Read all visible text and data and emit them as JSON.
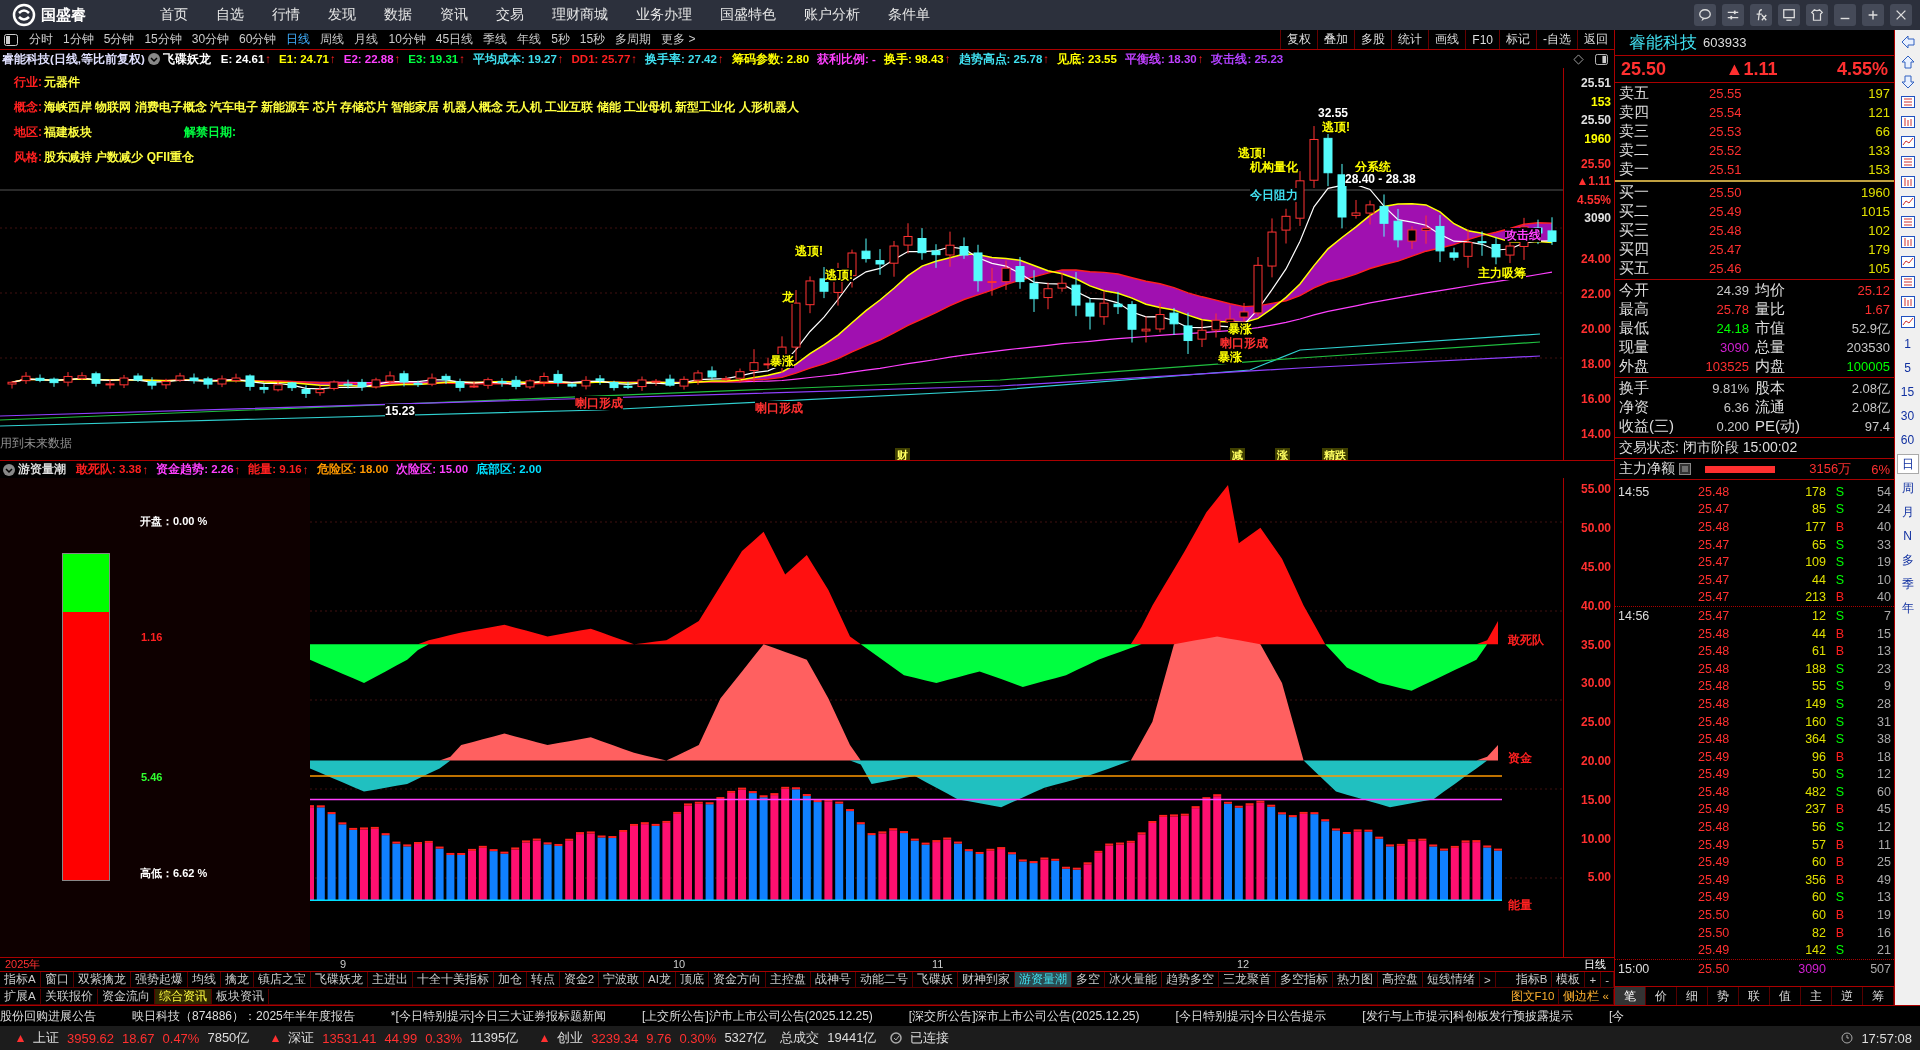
{
  "app": {
    "name": "国盛睿",
    "menu": [
      "首页",
      "自选",
      "行情",
      "发现",
      "数据",
      "资讯",
      "交易",
      "理财商城",
      "业务办理",
      "国盛特色",
      "账户分析",
      "条件单"
    ]
  },
  "period_bar": {
    "items": [
      {
        "label": "分时",
        "selected": false
      },
      {
        "label": "1分钟",
        "selected": false
      },
      {
        "label": "5分钟",
        "selected": false
      },
      {
        "label": "15分钟",
        "selected": false
      },
      {
        "label": "30分钟",
        "selected": false
      },
      {
        "label": "60分钟",
        "selected": false
      },
      {
        "label": "日线",
        "selected": true
      },
      {
        "label": "周线",
        "selected": false
      },
      {
        "label": "月线",
        "selected": false
      },
      {
        "label": "10分钟",
        "selected": false
      },
      {
        "label": "45日线",
        "selected": false
      },
      {
        "label": "季线",
        "selected": false
      },
      {
        "label": "年线",
        "selected": false
      },
      {
        "label": "5秒",
        "selected": false
      },
      {
        "label": "15秒",
        "selected": false
      },
      {
        "label": "多周期",
        "selected": false
      },
      {
        "label": "更多 >",
        "selected": false
      }
    ],
    "tools": [
      "复权",
      "叠加",
      "多股",
      "统计",
      "画线",
      "F10",
      "标记",
      "-自选",
      "返回"
    ]
  },
  "stock_header": {
    "title": "睿能科技(日线,等比前复权)",
    "indicator": "飞碟妖龙",
    "values": [
      {
        "label": "E:",
        "value": "24.61",
        "color": "#ffffff",
        "arrow": "↑"
      },
      {
        "label": "E1:",
        "value": "24.71",
        "color": "#ffff00",
        "arrow": "↑"
      },
      {
        "label": "E2:",
        "value": "22.88",
        "color": "#ff40ff",
        "arrow": "↑"
      },
      {
        "label": "E3:",
        "value": "19.31",
        "color": "#00ff40",
        "arrow": "↑"
      },
      {
        "label": "平均成本:",
        "value": "19.27",
        "color": "#40e0f0",
        "arrow": "↑"
      },
      {
        "label": "DD1:",
        "value": "25.77",
        "color": "#ff2020",
        "arrow": "↑"
      },
      {
        "label": "换手率:",
        "value": "27.42",
        "color": "#40e0f0",
        "arrow": "↑"
      },
      {
        "label": "筹码参数:",
        "value": "2.80",
        "color": "#ffff00"
      },
      {
        "label": "获利比例:",
        "value": "-",
        "color": "#ff40ff"
      },
      {
        "label": "换手:",
        "value": "98.43",
        "color": "#ffff00",
        "arrow": "↑"
      },
      {
        "label": "趋势高点:",
        "value": "25.78",
        "color": "#40e0f0",
        "arrow": "↑"
      },
      {
        "label": "见底:",
        "value": "23.55",
        "color": "#ffff00"
      },
      {
        "label": "平衡线:",
        "value": "18.30",
        "color": "#c040ff",
        "arrow": "↑"
      },
      {
        "label": "攻击线:",
        "value": "25.23",
        "color": "#b040ff"
      }
    ]
  },
  "info_lines": [
    [
      {
        "label": "行业:",
        "value": "元器件",
        "color": "#ff2020"
      }
    ],
    [
      {
        "label": "概念:",
        "value": "海峡西岸 物联网 消费电子概念 汽车电子 新能源车 芯片 存储芯片 智能家居 机器人概念 无人机 工业互联 储能 工业母机 新型工业化 人形机器人",
        "color": "#ff2020"
      }
    ],
    [
      {
        "label": "地区:",
        "value": "福建板块",
        "color": "#ff2020"
      },
      {
        "label": "解禁日期:",
        "color": "#00ff40"
      }
    ],
    [
      {
        "label": "风格:",
        "value": "股东减持 户数减少 QFII重仓",
        "color": "#ff2020"
      }
    ]
  ],
  "main_chart": {
    "y_axis": [
      {
        "text": "25.51",
        "color": "#e0e0e0"
      },
      {
        "text": "153",
        "color": "#ffff00"
      },
      {
        "text": "25.50",
        "color": "#e0e0e0"
      },
      {
        "text": "1960",
        "color": "#ffff00"
      },
      {
        "text": "25.50",
        "color": "#ff3030"
      },
      {
        "text": "▲1.11",
        "color": "#ff3030"
      },
      {
        "text": "4.55%",
        "color": "#ff3030"
      },
      {
        "text": "3090",
        "color": "#e0e0e0"
      },
      {
        "text": "24.00",
        "color": "#ff3030"
      },
      {
        "text": "22.00",
        "color": "#ff3030"
      },
      {
        "text": "20.00",
        "color": "#ff3030"
      },
      {
        "text": "18.00",
        "color": "#ff3030"
      },
      {
        "text": "16.00",
        "color": "#ff3030"
      },
      {
        "text": "14.00",
        "color": "#ff3030"
      }
    ],
    "annotations": [
      {
        "text": "32.55",
        "kind": "price"
      },
      {
        "text": "逃顶!",
        "kind": "signal"
      },
      {
        "text": "逃顶!",
        "kind": "signal"
      },
      {
        "text": "机构量化",
        "kind": "signal"
      },
      {
        "text": "分系统",
        "kind": "signal"
      },
      {
        "text": "28.40 - 28.38",
        "kind": "price"
      },
      {
        "text": "今日阻力",
        "kind": "info"
      },
      {
        "text": "攻击线",
        "kind": "line"
      },
      {
        "text": "主力吸筹",
        "kind": "signal"
      },
      {
        "text": "逃顶!",
        "kind": "signal"
      },
      {
        "text": "逃顶!",
        "kind": "signal"
      },
      {
        "text": "龙",
        "kind": "signal"
      },
      {
        "text": "暴涨",
        "kind": "signal"
      },
      {
        "text": "15.23",
        "kind": "price"
      },
      {
        "text": "喇口形成",
        "kind": "warning"
      },
      {
        "text": "喇口形成",
        "kind": "warning"
      },
      {
        "text": "暴涨",
        "kind": "signal"
      },
      {
        "text": "喇口形成",
        "kind": "warning"
      },
      {
        "text": "暴涨",
        "kind": "signal"
      },
      {
        "text": "用到未来数据",
        "kind": "note"
      },
      {
        "text": "财",
        "kind": "mark"
      },
      {
        "text": "减",
        "kind": "mark"
      },
      {
        "text": "涨",
        "kind": "mark"
      },
      {
        "text": "精跌",
        "kind": "mark"
      }
    ]
  },
  "indicator": {
    "title": "游资量潮",
    "values": [
      {
        "label": "敢死队:",
        "value": "3.38",
        "color": "#ff2020",
        "arrow": "↑"
      },
      {
        "label": "资金趋势:",
        "value": "2.26",
        "color": "#ff40ff",
        "arrow": "↑"
      },
      {
        "label": "能量:",
        "value": "9.16",
        "color": "#ff2020",
        "arrow": "↑"
      },
      {
        "label": "危险区:",
        "value": "18.00",
        "color": "#ff9900"
      },
      {
        "label": "次险区:",
        "value": "15.00",
        "color": "#ff40ff"
      },
      {
        "label": "底部区:",
        "value": "2.00",
        "color": "#00e0ff"
      }
    ],
    "panel": {
      "open": "开盘：0.00 %",
      "upper": "1.16",
      "lower": "5.46",
      "range": "高低：6.62 %"
    },
    "y_axis": [
      "55.00",
      "50.00",
      "45.00",
      "40.00",
      "35.00",
      "30.00",
      "25.00",
      "20.00",
      "15.00",
      "10.00",
      "5.00"
    ],
    "series_labels": [
      {
        "text": "敢死队",
        "color": "#ff2020"
      },
      {
        "text": "资金",
        "color": "#ff2020"
      },
      {
        "text": "能量",
        "color": "#ff2020"
      }
    ]
  },
  "x_axis": {
    "labels": [
      "2025年",
      "9",
      "10",
      "11",
      "12"
    ],
    "period": "日线"
  },
  "indicator_tabs": {
    "items": [
      {
        "label": "指标A",
        "selected": false
      },
      {
        "label": "窗口",
        "selected": false
      },
      {
        "label": "双紫擒龙",
        "selected": false
      },
      {
        "label": "强势起爆",
        "selected": false
      },
      {
        "label": "均线",
        "selected": false
      },
      {
        "label": "擒龙",
        "selected": false
      },
      {
        "label": "镇店之宝",
        "selected": false
      },
      {
        "label": "飞碟妖龙",
        "selected": false
      },
      {
        "label": "主进出",
        "selected": false
      },
      {
        "label": "十全十美指标",
        "selected": false
      },
      {
        "label": "加仓",
        "selected": false
      },
      {
        "label": "转点",
        "selected": false
      },
      {
        "label": "资金2",
        "selected": false
      },
      {
        "label": "宁波敢",
        "selected": false
      },
      {
        "label": "AI龙",
        "selected": false
      },
      {
        "label": "顶底",
        "selected": false
      },
      {
        "label": "资金方向",
        "selected": false
      },
      {
        "label": "主控盘",
        "selected": false
      },
      {
        "label": "战神号",
        "selected": false
      },
      {
        "label": "动能二号",
        "selected": false
      },
      {
        "label": "飞碟妖",
        "selected": false
      },
      {
        "label": "财神到家",
        "selected": false
      },
      {
        "label": "游资量潮",
        "selected": true
      },
      {
        "label": "多空",
        "selected": false
      },
      {
        "label": "冰火量能",
        "selected": false
      },
      {
        "label": "趋势多空",
        "selected": false
      },
      {
        "label": "三龙聚首",
        "selected": false
      },
      {
        "label": "多空指标",
        "selected": false
      },
      {
        "label": "热力图",
        "selected": false
      },
      {
        "label": "高控盘",
        "selected": false
      },
      {
        "label": "短线情绪",
        "selected": false
      },
      {
        "label": ">",
        "selected": false
      }
    ],
    "right": [
      "指标B",
      "模板",
      "+",
      "-"
    ]
  },
  "extension_tabs": {
    "items": [
      {
        "label": "扩展A",
        "selected": false
      },
      {
        "label": "关联报价",
        "selected": false
      },
      {
        "label": "资金流向",
        "selected": false
      },
      {
        "label": "综合资讯",
        "selected": true
      },
      {
        "label": "板块资讯",
        "selected": false
      }
    ],
    "right": [
      "图文F10",
      "侧边栏 «"
    ]
  },
  "quote": {
    "name": "睿能科技",
    "code": "603933",
    "price": "25.50",
    "change": "▲1.11",
    "percent": "4.55%",
    "asks": [
      {
        "label": "卖五",
        "price": "25.55",
        "volume": "197"
      },
      {
        "label": "卖四",
        "price": "25.54",
        "volume": "121"
      },
      {
        "label": "卖三",
        "price": "25.53",
        "volume": "66"
      },
      {
        "label": "卖二",
        "price": "25.52",
        "volume": "133"
      },
      {
        "label": "卖一",
        "price": "25.51",
        "volume": "153"
      }
    ],
    "bids": [
      {
        "label": "买一",
        "price": "25.50",
        "volume": "1960"
      },
      {
        "label": "买二",
        "price": "25.49",
        "volume": "1015"
      },
      {
        "label": "买三",
        "price": "25.48",
        "volume": "102"
      },
      {
        "label": "买四",
        "price": "25.47",
        "volume": "179"
      },
      {
        "label": "买五",
        "price": "25.46",
        "volume": "105"
      }
    ],
    "stat_blocks": [
      [
        {
          "label": "今开",
          "value": "24.39",
          "color": "#c8c8c8"
        },
        {
          "label": "均价",
          "value": "25.12",
          "color": "#ff3030"
        },
        {
          "label": "最高",
          "value": "25.78",
          "color": "#ff3030"
        },
        {
          "label": "量比",
          "value": "1.67",
          "color": "#ff3030"
        },
        {
          "label": "最低",
          "value": "24.18",
          "color": "#00ff00"
        },
        {
          "label": "市值",
          "value": "52.9亿",
          "color": "#c8c8c8"
        },
        {
          "label": "现量",
          "value": "3090",
          "color": "#d020d0"
        },
        {
          "label": "总量",
          "value": "203530",
          "color": "#c8c8c8"
        },
        {
          "label": "外盘",
          "value": "103525",
          "color": "#ff3030"
        },
        {
          "label": "内盘",
          "value": "100005",
          "color": "#00ff00"
        }
      ],
      [
        {
          "label": "换手",
          "value": "9.81%",
          "color": "#c8c8c8"
        },
        {
          "label": "股本",
          "value": "2.08亿",
          "color": "#c8c8c8"
        },
        {
          "label": "净资",
          "value": "6.36",
          "color": "#c8c8c8"
        },
        {
          "label": "流通",
          "value": "2.08亿",
          "color": "#c8c8c8"
        },
        {
          "label": "收益(三)",
          "value": "0.200",
          "color": "#c8c8c8"
        },
        {
          "label": "PE(动)",
          "value": "97.4",
          "color": "#c8c8c8"
        }
      ]
    ],
    "trade_status": "交易状态: 闭市阶段 15:00:02",
    "main_force": {
      "label": "主力净额",
      "value": "3156万",
      "percent": "6%"
    },
    "ticks": [
      {
        "time": "14:55",
        "price": "25.48",
        "volume": "178",
        "side": "S",
        "kind": "sell",
        "count": "54"
      },
      {
        "price": "25.47",
        "volume": "85",
        "side": "S",
        "kind": "sell",
        "count": "24"
      },
      {
        "price": "25.48",
        "volume": "177",
        "side": "B",
        "kind": "buy",
        "count": "40"
      },
      {
        "price": "25.47",
        "volume": "65",
        "side": "S",
        "kind": "sell",
        "count": "33"
      },
      {
        "price": "25.47",
        "volume": "109",
        "side": "S",
        "kind": "sell",
        "count": "19"
      },
      {
        "price": "25.47",
        "volume": "44",
        "side": "S",
        "kind": "sell",
        "count": "10"
      },
      {
        "price": "25.47",
        "volume": "213",
        "side": "B",
        "kind": "buy",
        "count": "40"
      },
      {
        "time": "14:56",
        "price": "25.47",
        "volume": "12",
        "side": "S",
        "kind": "sell",
        "count": "7"
      },
      {
        "price": "25.48",
        "volume": "44",
        "side": "B",
        "kind": "buy",
        "count": "15"
      },
      {
        "price": "25.48",
        "volume": "61",
        "side": "B",
        "kind": "buy",
        "count": "13"
      },
      {
        "price": "25.48",
        "volume": "188",
        "side": "S",
        "kind": "sell",
        "count": "23"
      },
      {
        "price": "25.48",
        "volume": "55",
        "side": "S",
        "kind": "sell",
        "count": "9"
      },
      {
        "price": "25.48",
        "volume": "149",
        "side": "S",
        "kind": "sell",
        "count": "28"
      },
      {
        "price": "25.48",
        "volume": "160",
        "side": "S",
        "kind": "sell",
        "count": "31"
      },
      {
        "price": "25.48",
        "volume": "364",
        "side": "S",
        "kind": "sell",
        "count": "38"
      },
      {
        "price": "25.49",
        "volume": "96",
        "side": "B",
        "kind": "buy",
        "count": "18"
      },
      {
        "price": "25.49",
        "volume": "50",
        "side": "S",
        "kind": "sell",
        "count": "12"
      },
      {
        "price": "25.48",
        "volume": "482",
        "side": "S",
        "kind": "sell",
        "count": "60"
      },
      {
        "price": "25.49",
        "volume": "237",
        "side": "B",
        "kind": "buy",
        "count": "45"
      },
      {
        "price": "25.48",
        "volume": "56",
        "side": "S",
        "kind": "sell",
        "count": "12"
      },
      {
        "price": "25.49",
        "volume": "57",
        "side": "B",
        "kind": "buy",
        "count": "11"
      },
      {
        "price": "25.49",
        "volume": "60",
        "side": "B",
        "kind": "buy",
        "count": "25"
      },
      {
        "price": "25.49",
        "volume": "356",
        "side": "B",
        "kind": "buy",
        "count": "49"
      },
      {
        "price": "25.49",
        "volume": "60",
        "side": "S",
        "kind": "sell",
        "count": "13"
      },
      {
        "price": "25.50",
        "volume": "60",
        "side": "B",
        "kind": "buy",
        "count": "19"
      },
      {
        "price": "25.50",
        "volume": "82",
        "side": "B",
        "kind": "buy",
        "count": "16"
      },
      {
        "price": "25.49",
        "volume": "142",
        "side": "S",
        "kind": "sell",
        "count": "21"
      },
      {
        "time": "15:00",
        "price": "25.50",
        "volume": "3090",
        "kind": "close",
        "count": "507"
      }
    ],
    "bottom_tabs": [
      {
        "label": "笔",
        "selected": true
      },
      {
        "label": "价",
        "selected": false
      },
      {
        "label": "细",
        "selected": false
      },
      {
        "label": "势",
        "selected": false
      },
      {
        "label": "联",
        "selected": false
      },
      {
        "label": "值",
        "selected": false
      },
      {
        "label": "主",
        "selected": false
      },
      {
        "label": "逆",
        "selected": false
      },
      {
        "label": "筹",
        "selected": false
      }
    ]
  },
  "side_strip": {
    "periods": [
      {
        "label": "1",
        "selected": false
      },
      {
        "label": "5",
        "selected": false
      },
      {
        "label": "15",
        "selected": false
      },
      {
        "label": "30",
        "selected": false
      },
      {
        "label": "60",
        "selected": false
      },
      {
        "label": "日",
        "selected": true
      },
      {
        "label": "周",
        "selected": false
      },
      {
        "label": "月",
        "selected": false
      },
      {
        "label": "N",
        "selected": false
      },
      {
        "label": "多",
        "selected": false
      },
      {
        "label": "季",
        "selected": false
      },
      {
        "label": "年",
        "selected": false
      }
    ]
  },
  "news_ticker": [
    "股份回购进展公告",
    "映日科技（874886）：2025年半年度报告",
    "*[今日特别提示]今日三大证券报标题新闻",
    "[上交所公告]沪市上市公司公告(2025.12.25)",
    "[深交所公告]深市上市公司公告(2025.12.25)",
    "[今日特别提示]今日公告提示",
    "[发行与上市提示]科创板发行预披露提示",
    "[今"
  ],
  "status_bar": {
    "indices": [
      {
        "name": "上证",
        "value": "3959.62",
        "change": "18.67",
        "percent": "0.47%",
        "amount": "7850亿"
      },
      {
        "name": "深证",
        "value": "13531.41",
        "change": "44.99",
        "percent": "0.33%",
        "amount": "11395亿"
      },
      {
        "name": "创业",
        "value": "3239.34",
        "change": "9.76",
        "percent": "0.30%",
        "amount": "5327亿"
      }
    ],
    "total_label": "总成交",
    "total": "19441亿",
    "connection": "已连接",
    "time": "17:57:08"
  }
}
